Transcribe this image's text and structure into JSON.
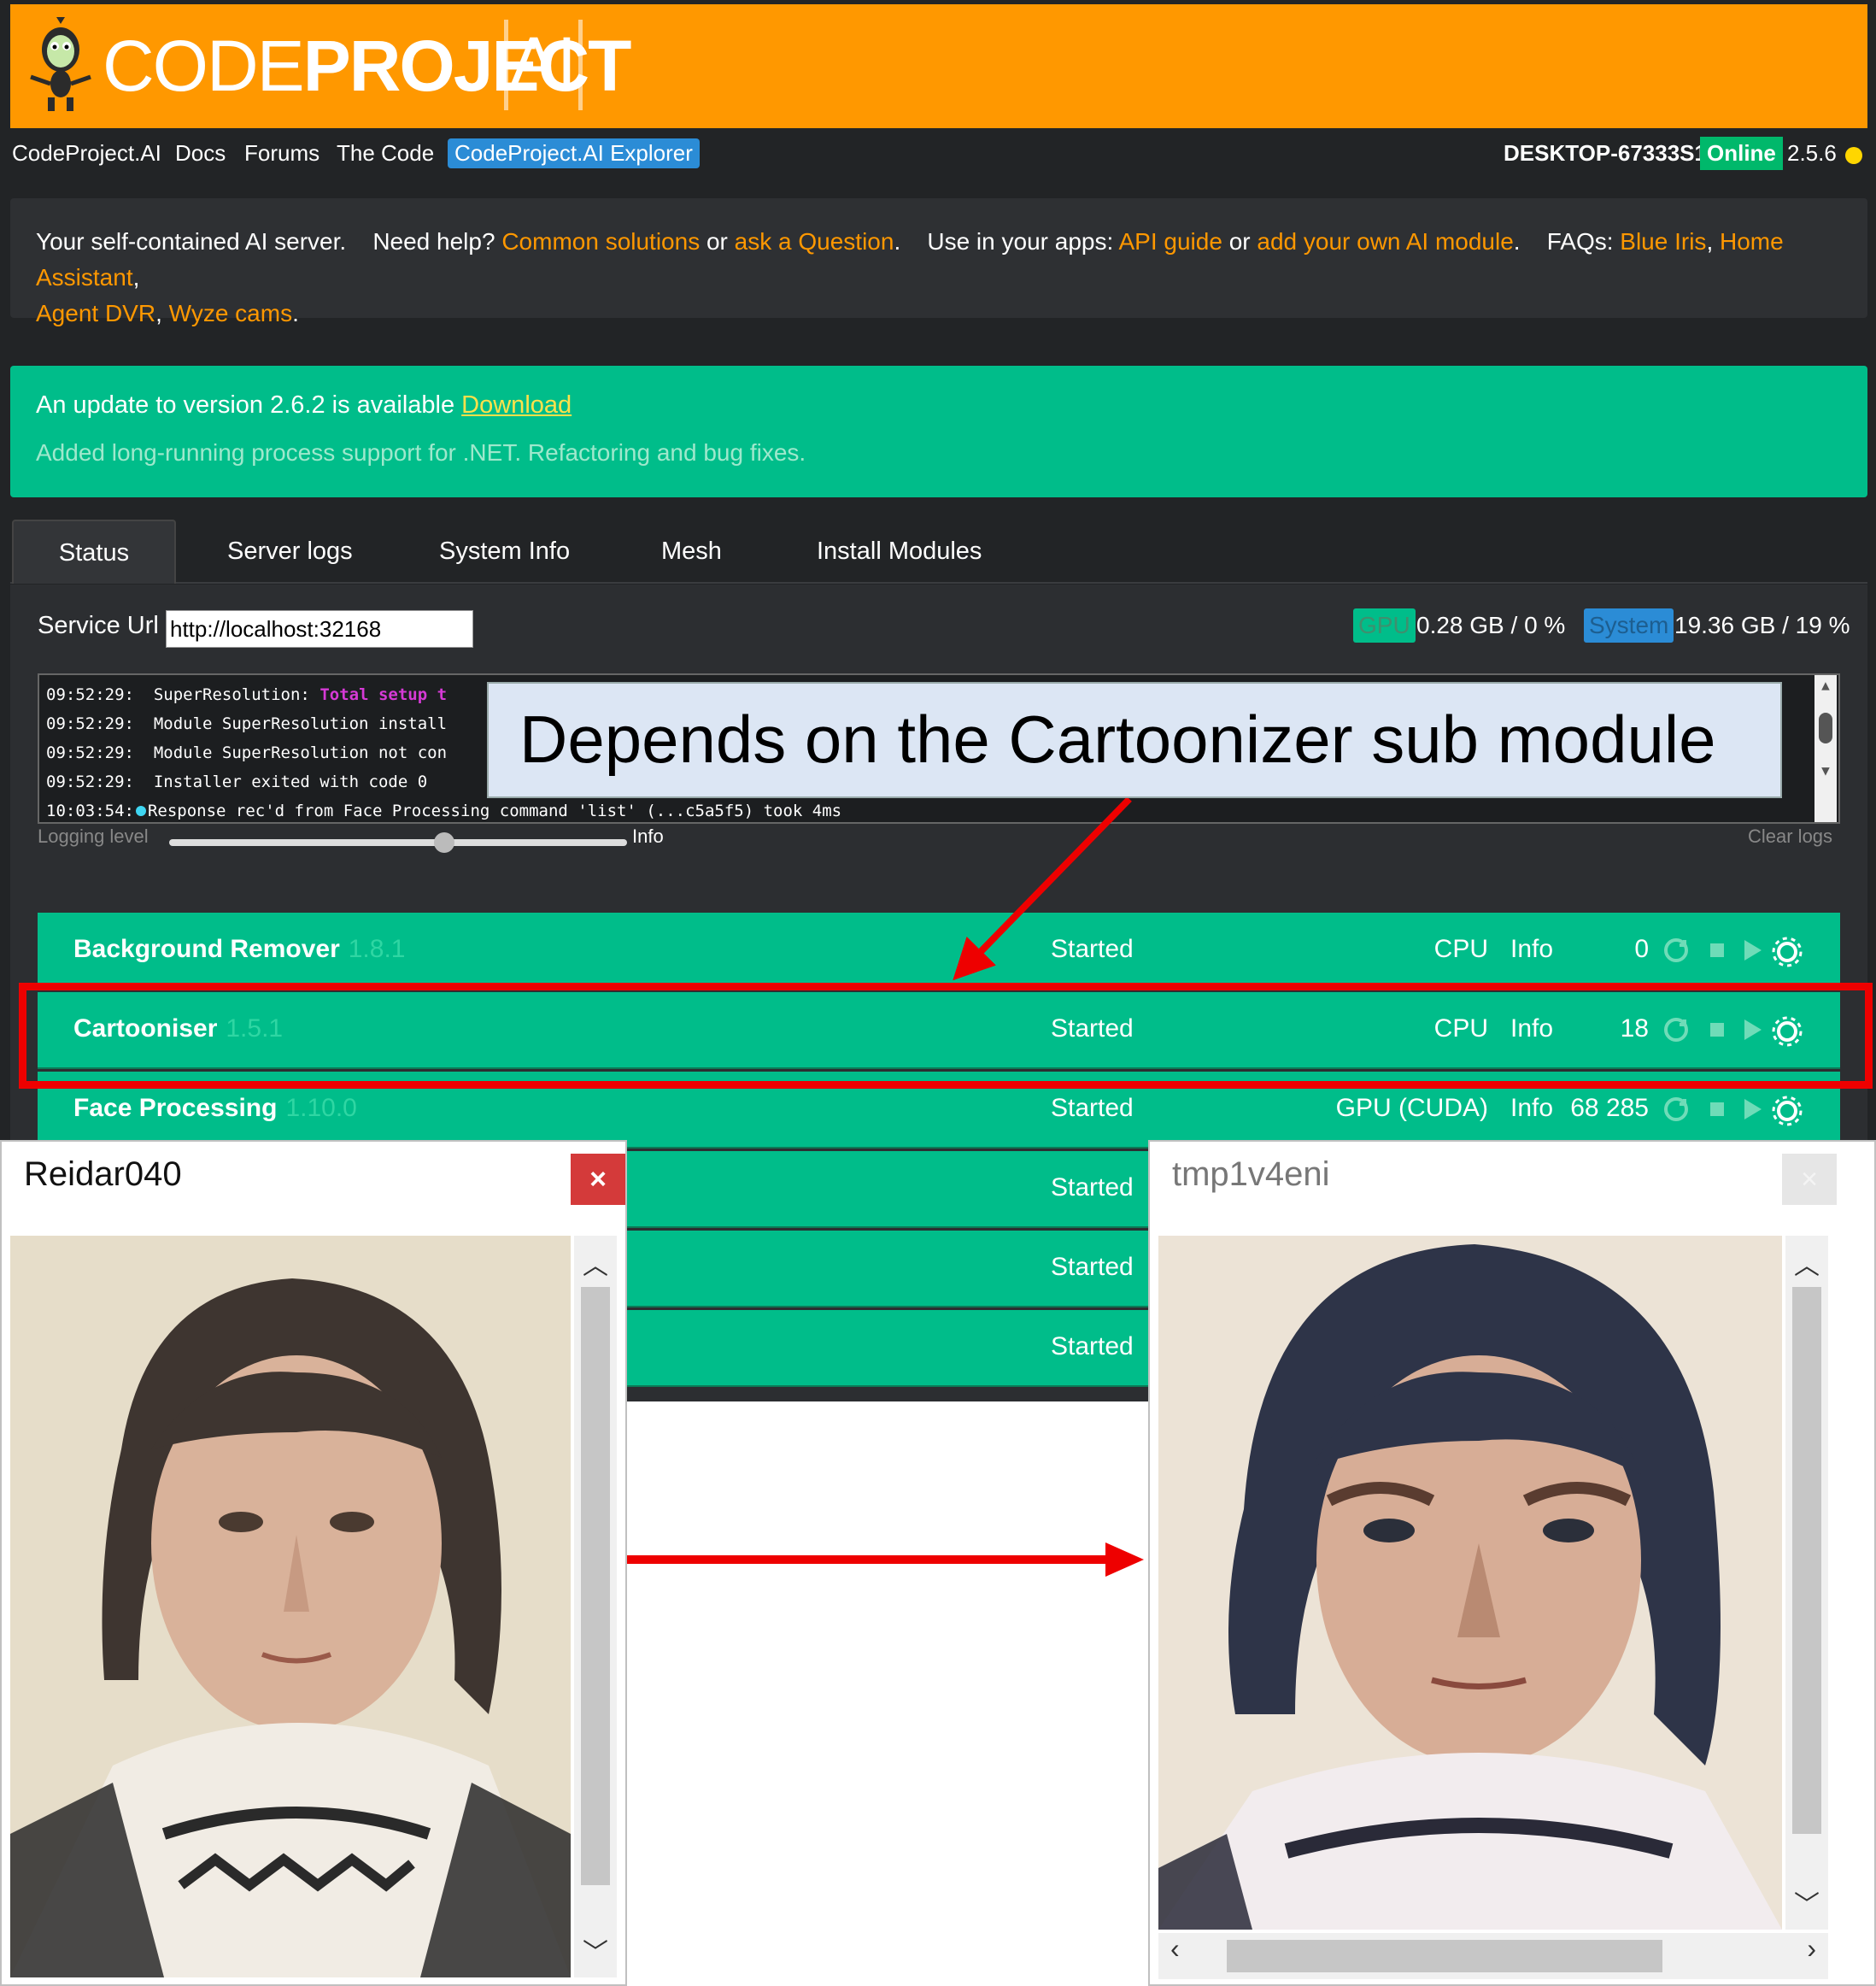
{
  "header": {
    "logo_text_regular": "CODE",
    "logo_text_bold": "PROJECT",
    "logo_text_ai": "AI"
  },
  "nav": {
    "items": [
      "CodeProject.AI",
      "Docs",
      "Forums",
      "The Code",
      "CodeProject.AI Explorer"
    ],
    "host": "DESKTOP-67333S1",
    "status": "Online",
    "version": "2.5.6"
  },
  "intro": {
    "t1": "Your self-contained AI server.",
    "t2": "Need help?",
    "l1": "Common solutions",
    "t3": "or",
    "l2": "ask a Question",
    "t4": ".",
    "t5": "Use in your apps:",
    "l3": "API guide",
    "t6": "or",
    "l4": "add your own AI module",
    "t7": ".",
    "t8": "FAQs:",
    "l5": "Blue Iris",
    "l6": "Home Assistant",
    "l7": "Agent DVR",
    "l8": "Wyze cams",
    "sep": ",",
    "end": "."
  },
  "update": {
    "title": "An update to version 2.6.2 is available",
    "download": "Download",
    "description": "Added long-running process support for .NET. Refactoring and bug fixes."
  },
  "tabs": [
    "Status",
    "Server logs",
    "System Info",
    "Mesh",
    "Install Modules"
  ],
  "status_panel": {
    "service_url_label": "Service Url",
    "service_url_value": "http://localhost:32168",
    "gpu_label": "GPU",
    "gpu_value": "0.28 GB / 0 %",
    "system_label": "System",
    "system_value": "19.36 GB / 19 %",
    "logs": [
      {
        "time": "09:52:29:",
        "text": "SuperResolution: ",
        "highlight": "Total setup t"
      },
      {
        "time": "09:52:29:",
        "text": "Module SuperResolution install"
      },
      {
        "time": "09:52:29:",
        "text": "Module SuperResolution not con"
      },
      {
        "time": "09:52:29:",
        "text": "Installer exited with code 0"
      },
      {
        "time": "10:03:54:",
        "text": "Response rec'd from Face Processing command 'list' (...c5a5f5) took 4ms"
      }
    ],
    "logging_level_label": "Logging level",
    "logging_level_value": "Info",
    "logging_level_fraction": 0.6,
    "clear_logs": "Clear logs"
  },
  "modules": [
    {
      "name": "Background Remover",
      "version": "1.8.1",
      "status": "Started",
      "device": "CPU",
      "info": "Info",
      "count": "0"
    },
    {
      "name": "Cartooniser",
      "version": "1.5.1",
      "status": "Started",
      "device": "CPU",
      "info": "Info",
      "count": "18"
    },
    {
      "name": "Face Processing",
      "version": "1.10.0",
      "status": "Started",
      "device": "GPU (CUDA)",
      "info": "Info",
      "count": "68 285"
    },
    {
      "name": "",
      "version": "",
      "status": "Started",
      "device": "",
      "info": "",
      "count": ""
    },
    {
      "name": "",
      "version": "",
      "status": "Started",
      "device": "",
      "info": "",
      "count": ""
    },
    {
      "name": "",
      "version": "",
      "status": "Started",
      "device": "",
      "info": "",
      "count": ""
    }
  ],
  "annotation": {
    "callout": "Depends on the Cartoonizer sub module",
    "highlight_color": "#ee0000"
  },
  "windows": {
    "left_title": "Reidar040",
    "left_close": "×",
    "right_title": "tmp1v4eni",
    "right_close": "×"
  },
  "colors": {
    "brand_orange": "#ff9800",
    "accent_green": "#00bd8a",
    "accent_blue": "#2b8cd6",
    "annotation_red": "#ee0000"
  }
}
